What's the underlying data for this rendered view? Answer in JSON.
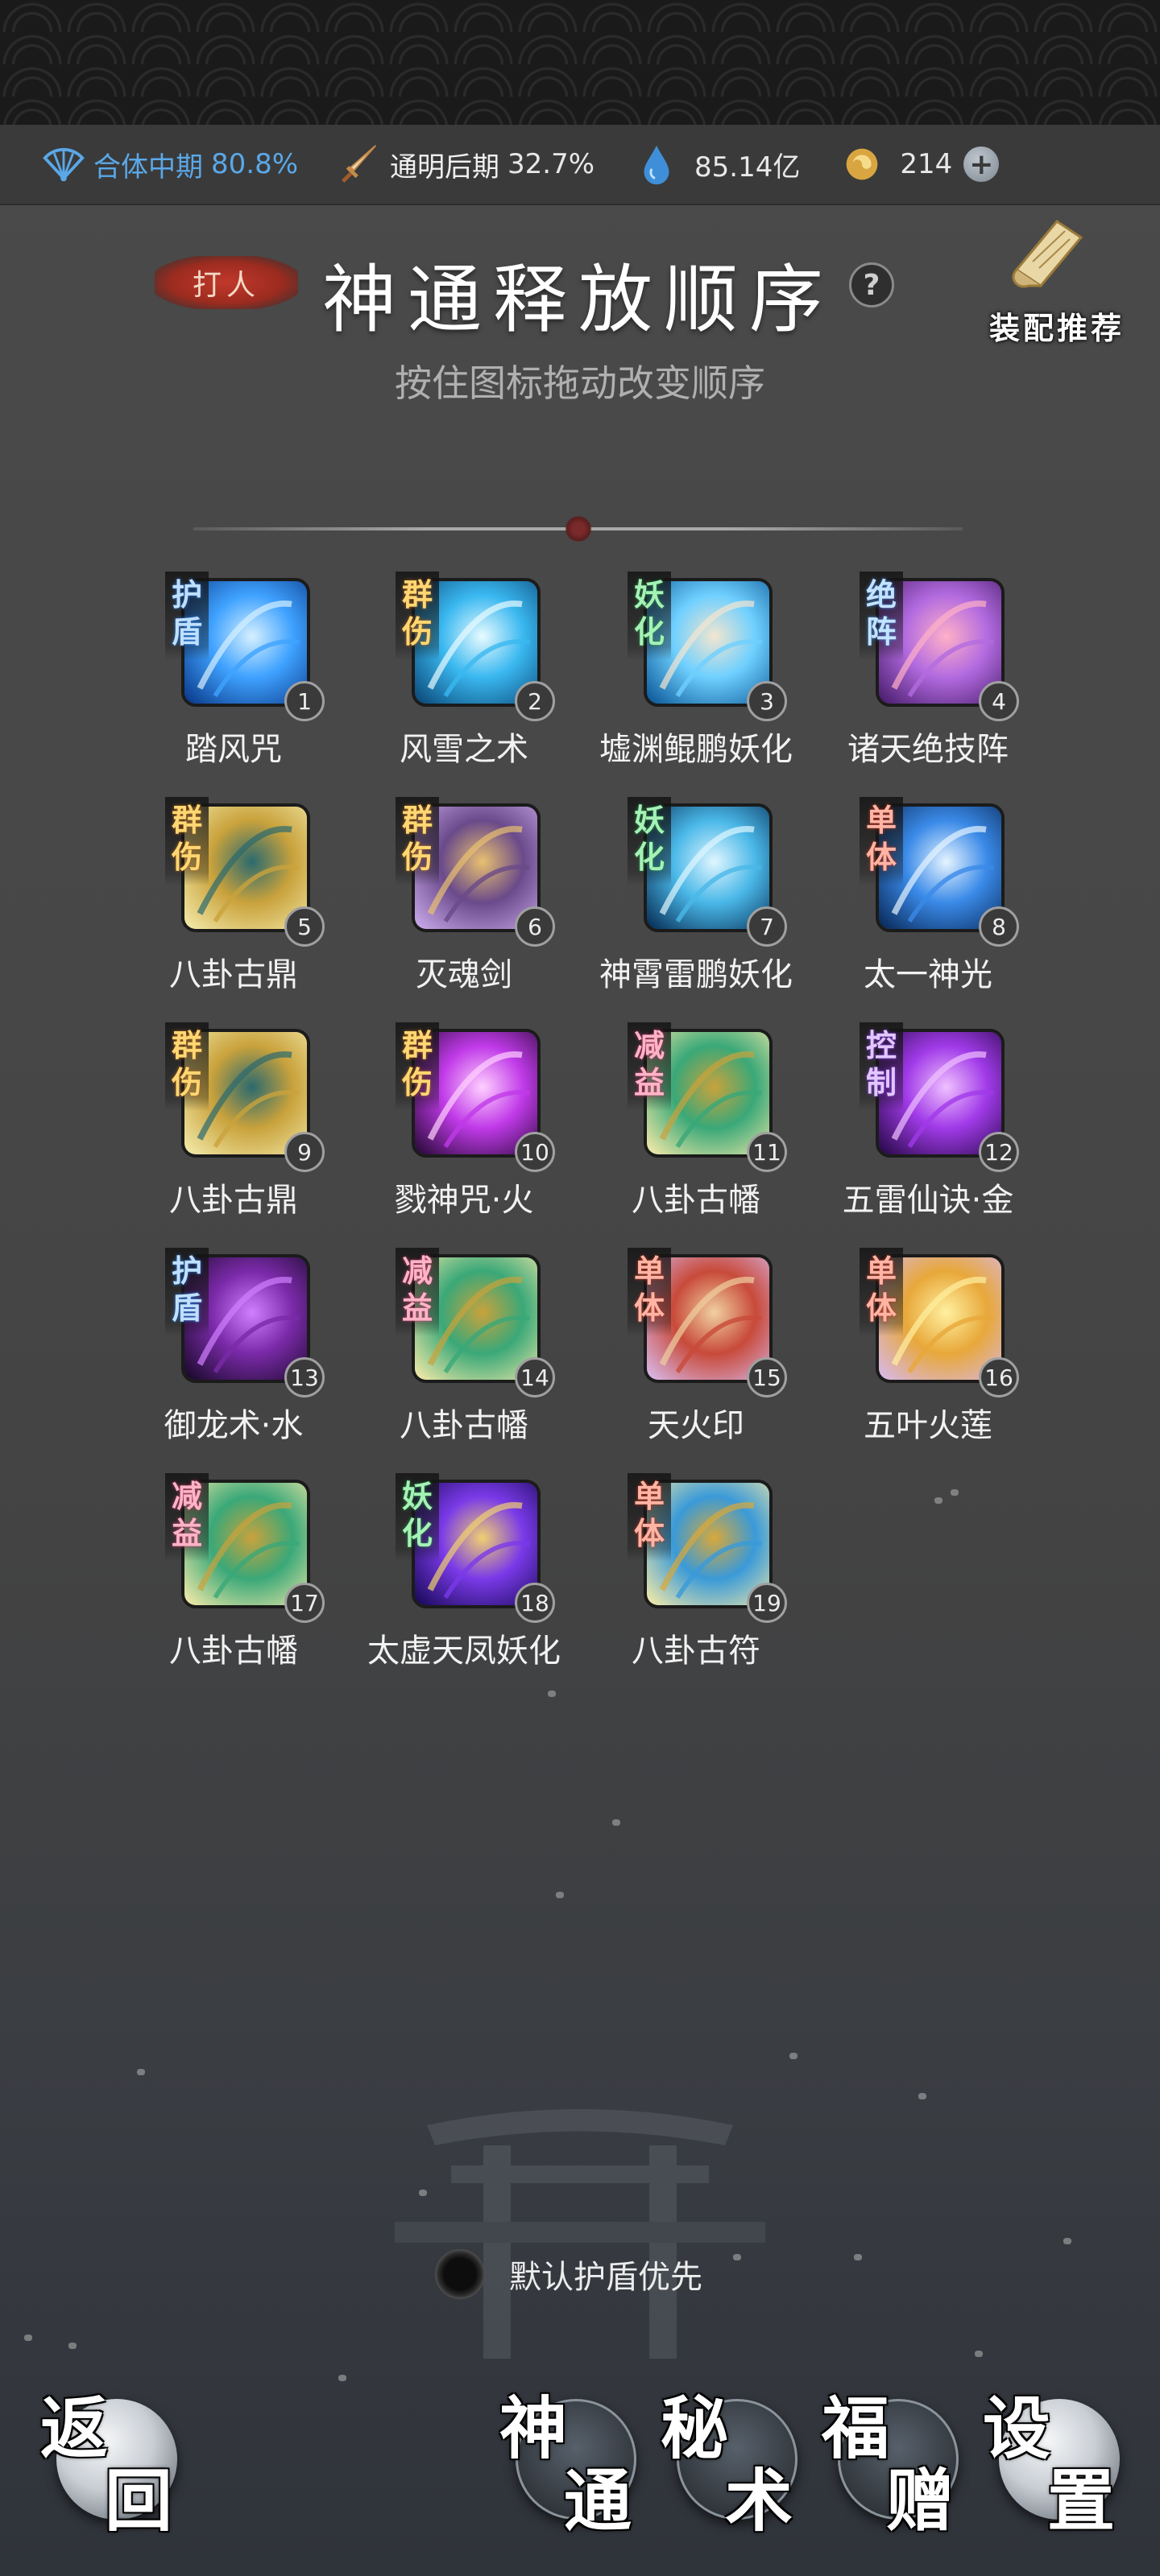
{
  "resources": [
    {
      "name": "合体中期",
      "value": "80.8%",
      "icon": "fan-icon",
      "color": "#5aa8e8"
    },
    {
      "name": "通明后期",
      "value": "32.7%",
      "icon": "sword-icon",
      "color": "#e8e8e8"
    },
    {
      "name": "",
      "value": "85.14亿",
      "icon": "water-drop-icon",
      "color": "#e8e8e8"
    },
    {
      "name": "",
      "value": "214",
      "icon": "spirit-coin-icon",
      "color": "#e8e8e8"
    }
  ],
  "header": {
    "tag": "打人",
    "title": "神通释放顺序",
    "help": "?",
    "recommend_label": "装配推荐",
    "subtitle": "按住图标拖动改变顺序"
  },
  "skills": [
    {
      "order": "1",
      "name": "踏风咒",
      "category": "护盾",
      "cat_class": "shield",
      "icon": "wind-spell-icon"
    },
    {
      "order": "2",
      "name": "风雪之术",
      "category": "群伤",
      "cat_class": "group",
      "icon": "blizzard-icon"
    },
    {
      "order": "3",
      "name": "墟渊鲲鹏妖化",
      "category": "妖化",
      "cat_class": "demon",
      "icon": "kunpeng-icon"
    },
    {
      "order": "4",
      "name": "诸天绝技阵",
      "category": "绝阵",
      "cat_class": "array",
      "icon": "orb-array-icon"
    },
    {
      "order": "5",
      "name": "八卦古鼎",
      "category": "群伤",
      "cat_class": "group",
      "icon": "cauldron-icon"
    },
    {
      "order": "6",
      "name": "灭魂剑",
      "category": "群伤",
      "cat_class": "group",
      "icon": "soul-sword-icon"
    },
    {
      "order": "7",
      "name": "神霄雷鹏妖化",
      "category": "妖化",
      "cat_class": "demon",
      "icon": "thunder-roc-icon"
    },
    {
      "order": "8",
      "name": "太一神光",
      "category": "单体",
      "cat_class": "single",
      "icon": "divine-light-icon"
    },
    {
      "order": "9",
      "name": "八卦古鼎",
      "category": "群伤",
      "cat_class": "group",
      "icon": "cauldron-icon"
    },
    {
      "order": "10",
      "name": "戮神咒·火",
      "category": "群伤",
      "cat_class": "group",
      "icon": "fire-curse-icon"
    },
    {
      "order": "11",
      "name": "八卦古幡",
      "category": "减益",
      "cat_class": "debuff",
      "icon": "banner-icon"
    },
    {
      "order": "12",
      "name": "五雷仙诀·金",
      "category": "控制",
      "cat_class": "control",
      "icon": "purple-lightning-icon"
    },
    {
      "order": "13",
      "name": "御龙术·水",
      "category": "护盾",
      "cat_class": "shield",
      "icon": "dragon-head-icon"
    },
    {
      "order": "14",
      "name": "八卦古幡",
      "category": "减益",
      "cat_class": "debuff",
      "icon": "banner-icon"
    },
    {
      "order": "15",
      "name": "天火印",
      "category": "单体",
      "cat_class": "single",
      "icon": "fire-seal-icon"
    },
    {
      "order": "16",
      "name": "五叶火莲",
      "category": "单体",
      "cat_class": "single",
      "icon": "lotus-icon"
    },
    {
      "order": "17",
      "name": "八卦古幡",
      "category": "减益",
      "cat_class": "debuff",
      "icon": "banner-icon"
    },
    {
      "order": "18",
      "name": "太虚天凤妖化",
      "category": "妖化",
      "cat_class": "demon",
      "icon": "phoenix-icon"
    },
    {
      "order": "19",
      "name": "八卦古符",
      "category": "单体",
      "cat_class": "single",
      "icon": "talisman-icon"
    }
  ],
  "default_toggle": {
    "label": "默认护盾优先",
    "checked": false
  },
  "nav": {
    "back": [
      "返",
      "回"
    ],
    "shentong": [
      "神",
      "通"
    ],
    "mishu": [
      "秘",
      "术"
    ],
    "fuzeng": [
      "福",
      "赠"
    ],
    "settings": [
      "设",
      "置"
    ]
  },
  "colors": {
    "accent_blue": "#5aa8e8",
    "tag_red": "#c0392b",
    "background": "#474747"
  }
}
